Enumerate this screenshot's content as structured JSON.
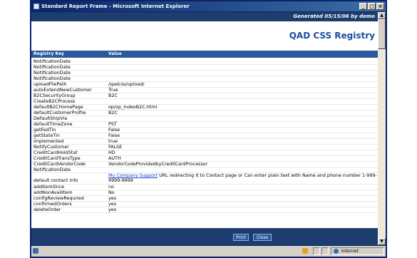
{
  "window": {
    "title": "Standard Report Frame - Microsoft Internet Explorer",
    "min": "_",
    "max": "□",
    "close": "×"
  },
  "report": {
    "generated": "Generated 05/15/06 by demo",
    "title": "QAD CSS Registry",
    "header_key": "Registry Key",
    "header_value": "Value"
  },
  "rows": [
    {
      "key": "NotificationDate",
      "value": ""
    },
    {
      "key": "NotificationDate",
      "value": ""
    },
    {
      "key": "NotificationDate",
      "value": ""
    },
    {
      "key": "NotificationDate",
      "value": ""
    },
    {
      "key": "uploadFilePath",
      "value": "/qadcss/upload/"
    },
    {
      "key": "autoExtendNewCustomer",
      "value": "True"
    },
    {
      "key": "B2CSecurityGroup",
      "value": "B2C"
    },
    {
      "key": "CreateB2CProcess",
      "value": ""
    },
    {
      "key": "defaultB2CHomePage",
      "value": "op/op_indexB2C.html"
    },
    {
      "key": "defaultCustomerProfile",
      "value": "B2C"
    },
    {
      "key": "DefaultShipVia",
      "value": ""
    },
    {
      "key": "defaultTimeZone",
      "value": "PST"
    },
    {
      "key": "getFedTin",
      "value": "False"
    },
    {
      "key": "getStateTin",
      "value": "False"
    },
    {
      "key": "implemented",
      "value": "true"
    },
    {
      "key": "NotifyCustomer",
      "value": "FALSE"
    },
    {
      "key": "CreditCardHoldStat",
      "value": "HD"
    },
    {
      "key": "CreditCardTransType",
      "value": "AUTH"
    },
    {
      "key": "CreditCardVendorCode",
      "value": "VendorCodeProvidedbyCreditCardProcessor"
    },
    {
      "key": "NotificationDate",
      "value": ""
    }
  ],
  "contact_row": {
    "key": "default contact info",
    "link": "My Company Support",
    "text": " URL redirecting it to Contact page or Can enter plain text with Name and phone number 1-999-9999-9999"
  },
  "rows2": [
    {
      "key": "addItemOnce",
      "value": "no"
    },
    {
      "key": "addNonAvailItem",
      "value": "No"
    },
    {
      "key": "configReviewRequired",
      "value": "yes"
    },
    {
      "key": "confirmedOrders",
      "value": "yes"
    },
    {
      "key": "deleteOrder",
      "value": "yes"
    }
  ],
  "footer": {
    "print": "Print",
    "close": "Close"
  },
  "status": {
    "zone": "Internet"
  }
}
